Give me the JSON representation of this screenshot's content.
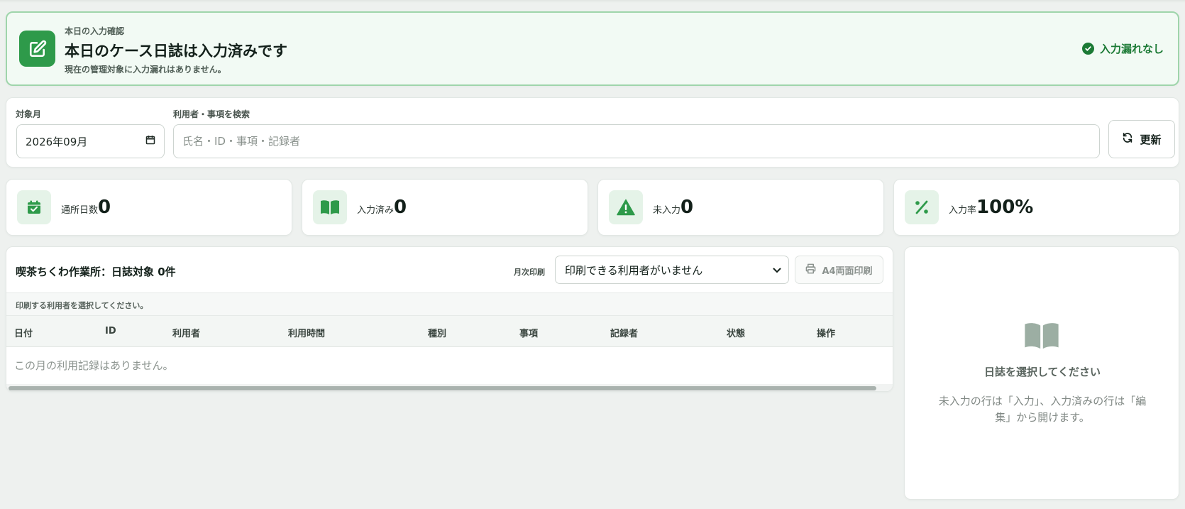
{
  "banner": {
    "eyebrow": "本日の入力確認",
    "title": "本日のケース日誌は入力済みです",
    "subtitle": "現在の管理対象に入力漏れはありません。",
    "status": "入力漏れなし",
    "icon": "edit-icon"
  },
  "filter": {
    "month_label": "対象月",
    "month_value": "2026年09月",
    "search_label": "利用者・事項を検索",
    "search_placeholder": "氏名・ID・事項・記録者",
    "search_value": "",
    "refresh_label": "更新"
  },
  "stats": [
    {
      "label": "通所日数",
      "value": "0",
      "icon": "calendar-check-icon"
    },
    {
      "label": "入力済み",
      "value": "0",
      "icon": "book-open-icon"
    },
    {
      "label": "未入力",
      "value": "0",
      "icon": "warning-icon"
    },
    {
      "label": "入力率",
      "value": "100%",
      "icon": "percent-icon"
    }
  ],
  "table": {
    "title": "喫茶ちくわ作業所：日誌対象 0件",
    "print_label": "月次印刷",
    "print_select_value": "印刷できる利用者がいません",
    "print_button": "A4両面印刷",
    "notice": "印刷する利用者を選択してください。",
    "columns": [
      "日付",
      "ID",
      "利用者",
      "利用時間",
      "種別",
      "事項",
      "記録者",
      "状態",
      "操作"
    ],
    "empty_message": "この月の利用記録はありません。"
  },
  "detail": {
    "title": "日誌を選択してください",
    "description": "未入力の行は「入力」、入力済みの行は「編集」から開けます。"
  },
  "colors": {
    "accent": "#2e9a4a",
    "accent_dark": "#1c7a35",
    "banner_bg": "#f2faf4",
    "banner_border": "#9fd5ab"
  }
}
